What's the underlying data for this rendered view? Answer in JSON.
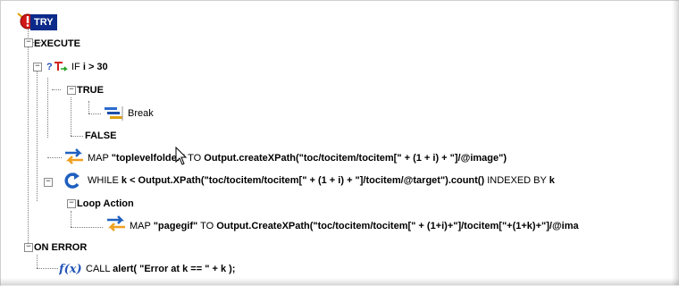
{
  "tree": {
    "try_label": "TRY",
    "execute_label": "EXECUTE",
    "if": {
      "keyword": "IF",
      "condition": "i > 30"
    },
    "true_label": "TRUE",
    "break_label": "Break",
    "false_label": "FALSE",
    "map1": {
      "keyword": "MAP",
      "source": "\"toplevelfolder\"",
      "to": "TO",
      "target": "Output.createXPath(\"toc/tocitem/tocitem[\" + (1 + i) + \"]/@image\")"
    },
    "while": {
      "keyword": "WHILE",
      "condition": "k < Output.XPath(\"toc/tocitem/tocitem[\" + (1 + i) + \"]/tocitem/@target\").count()",
      "indexed_by": "INDEXED BY",
      "index_var": "k"
    },
    "loop_action_label": "Loop Action",
    "map2": {
      "keyword": "MAP",
      "source": "\"pagegif\"",
      "to": "TO",
      "target": "Output.CreateXPath(\"toc/tocitem/tocitem[\" + (1+i)+\"]/tocitem[\"+(1+k)+\"]/@ima"
    },
    "on_error_label": "ON ERROR",
    "call": {
      "keyword": "CALL",
      "expression": "alert( \"Error at k == \" + k );"
    }
  },
  "icons": {
    "try": "error-exclamation-icon",
    "if": "branch-question-icon",
    "break": "break-icon",
    "map": "map-arrows-icon",
    "while": "loop-arrow-icon",
    "call": "function-fx-icon",
    "cursor": "mouse-pointer-icon"
  },
  "colors": {
    "selection_bg": "#0b2a8a",
    "map_arrow_blue": "#2060c0",
    "map_arrow_orange": "#f0a020",
    "while_blue": "#1f5fbf",
    "fx_blue": "#2456b8",
    "try_red": "#d01818"
  }
}
